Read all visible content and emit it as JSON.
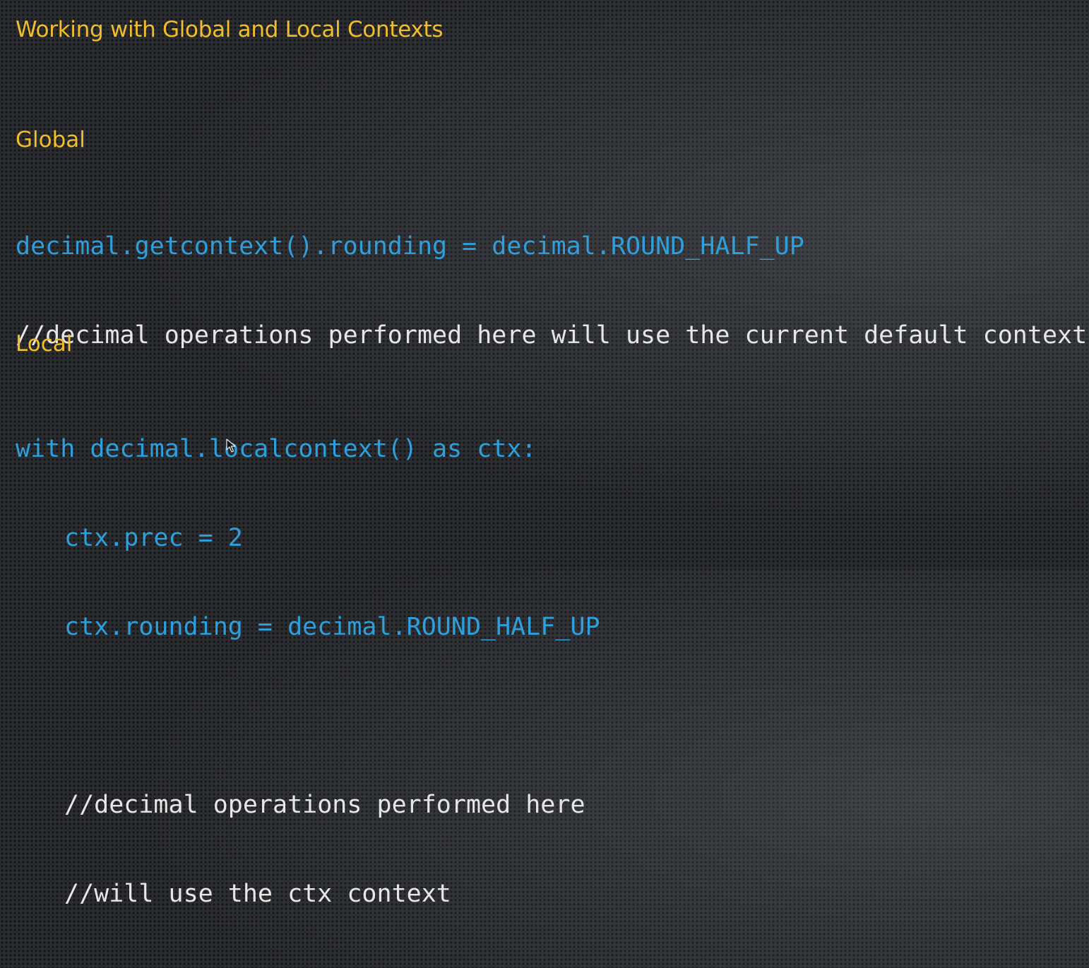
{
  "slide": {
    "title": "Working with Global and Local Contexts",
    "global": {
      "heading": "Global",
      "lines": [
        "decimal.getcontext().rounding = decimal.ROUND_HALF_UP",
        "//decimal operations performed here will use the current default context"
      ]
    },
    "local": {
      "heading": "Local",
      "lines": [
        "with decimal.localcontext() as ctx:",
        "ctx.prec = 2",
        "ctx.rounding = decimal.ROUND_HALF_UP",
        "",
        "//decimal operations performed here",
        "//will use the ctx context"
      ]
    }
  },
  "colors": {
    "heading": "#f0bd2c",
    "code": "#2f9fdc",
    "comment": "#e6e6e6",
    "background": "#2b2d31"
  },
  "icons": {
    "cursor": "mouse-pointer-icon"
  }
}
